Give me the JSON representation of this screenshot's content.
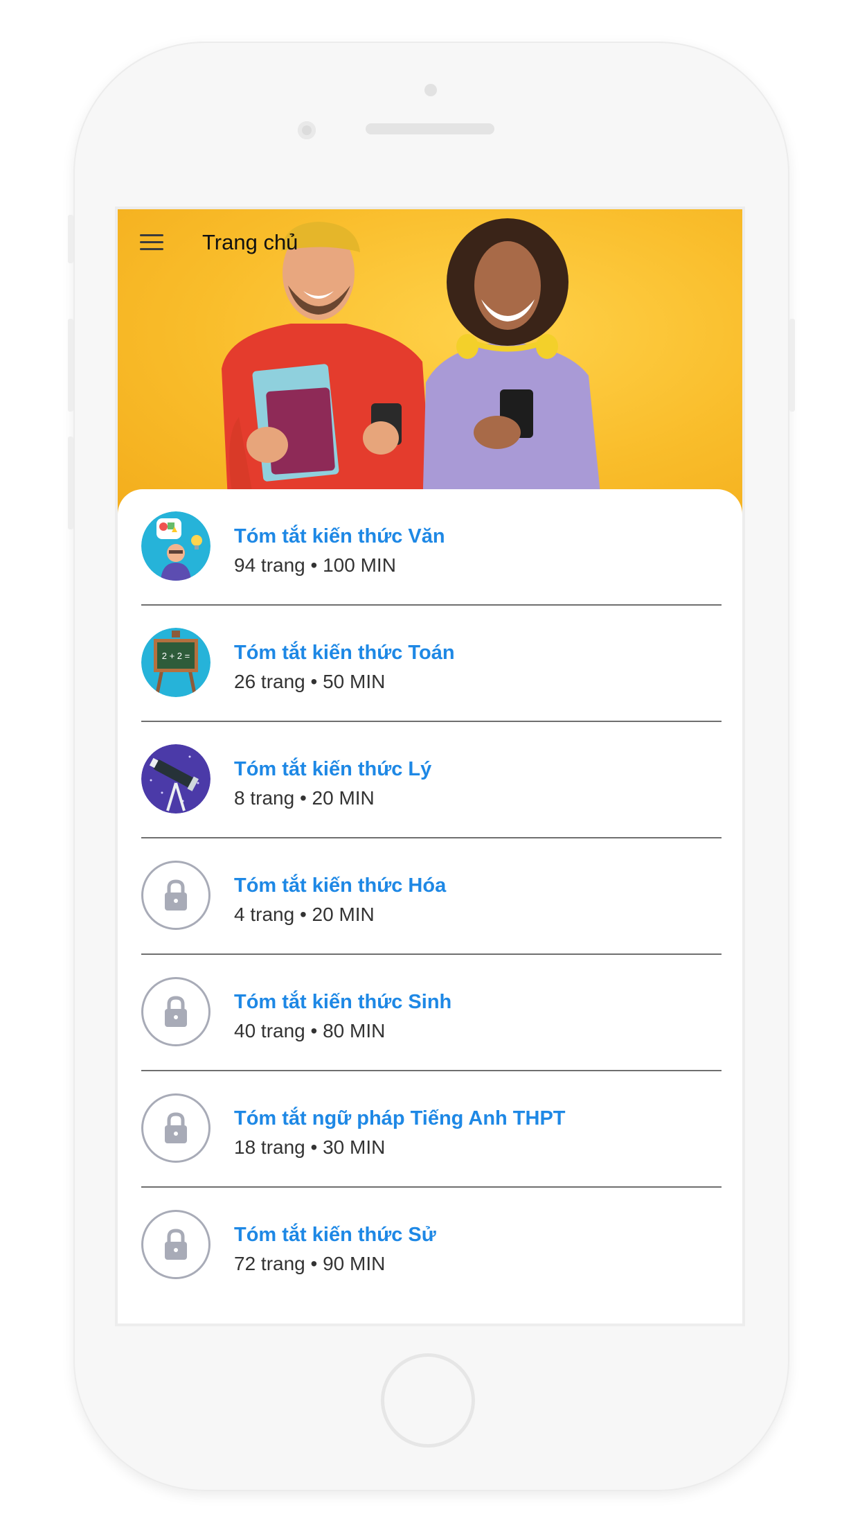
{
  "appbar": {
    "title": "Trang chủ",
    "menu_icon": "menu-icon"
  },
  "hero": {
    "description_icon": "hero-photo"
  },
  "colors": {
    "accent": "#1e88e5",
    "hero_bg": "#f9bd2b",
    "locked": "#a8abb7"
  },
  "lessons": [
    {
      "title": "Tóm tắt kiến thức Văn",
      "meta": "94 trang • 100 MIN",
      "icon": "literature-icon",
      "locked": false
    },
    {
      "title": "Tóm tắt kiến thức Toán",
      "meta": "26 trang • 50 MIN",
      "icon": "math-board-icon",
      "locked": false
    },
    {
      "title": "Tóm tắt kiến thức Lý",
      "meta": "8 trang • 20 MIN",
      "icon": "telescope-icon",
      "locked": false
    },
    {
      "title": "Tóm tắt kiến thức Hóa",
      "meta": "4 trang • 20 MIN",
      "icon": "lock-icon",
      "locked": true
    },
    {
      "title": "Tóm tắt kiến thức Sinh",
      "meta": "40 trang • 80 MIN",
      "icon": "lock-icon",
      "locked": true
    },
    {
      "title": "Tóm tắt ngữ pháp Tiếng Anh THPT",
      "meta": "18 trang • 30 MIN",
      "icon": "lock-icon",
      "locked": true
    },
    {
      "title": "Tóm tắt kiến thức Sử",
      "meta": "72 trang • 90 MIN",
      "icon": "lock-icon",
      "locked": true
    }
  ]
}
